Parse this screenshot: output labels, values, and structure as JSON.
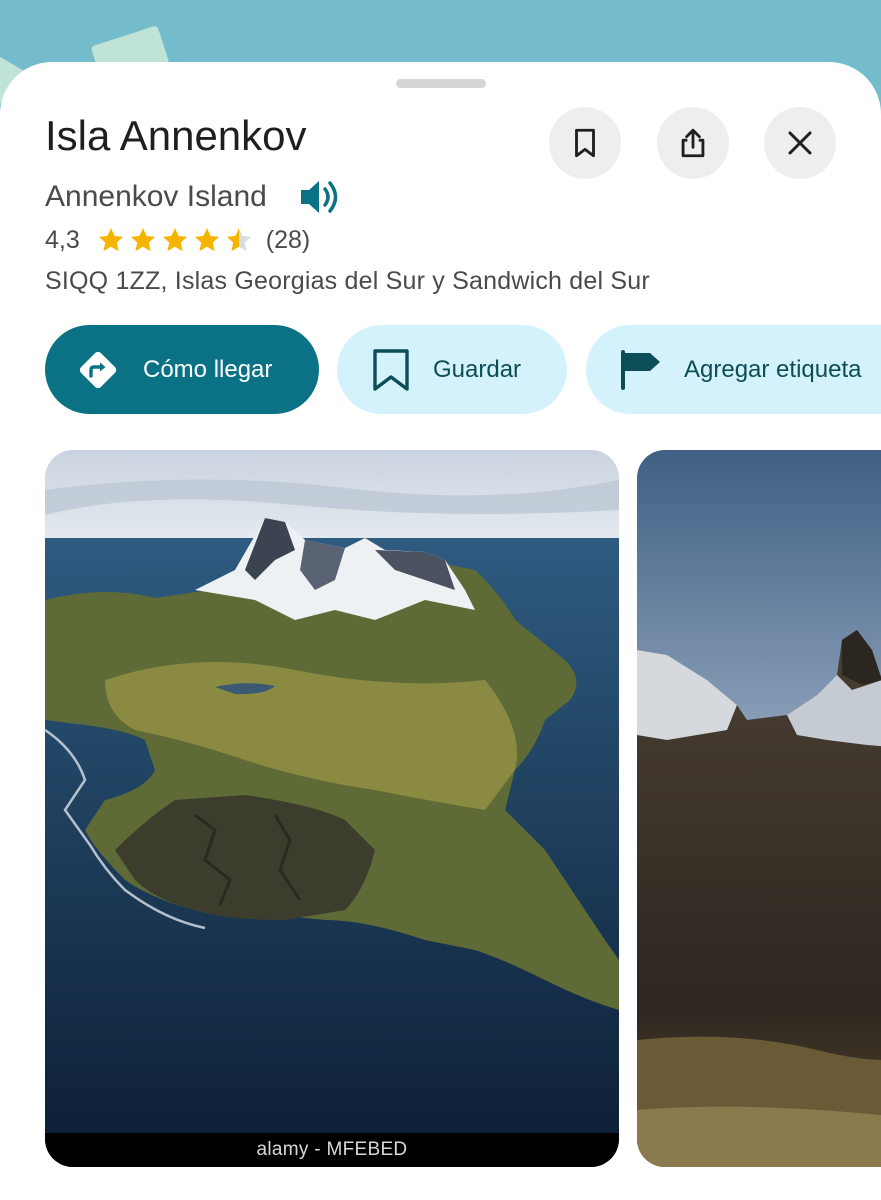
{
  "place": {
    "title": "Isla Annenkov",
    "subtitle": "Annenkov Island",
    "rating": "4,3",
    "rating_value": 4.3,
    "review_count": "(28)",
    "address": "SIQQ 1ZZ, Islas Georgias del Sur y Sandwich del Sur"
  },
  "header_actions": [
    {
      "icon": "bookmark-icon"
    },
    {
      "icon": "share-icon"
    },
    {
      "icon": "close-icon"
    }
  ],
  "chips": {
    "directions": {
      "label": "Cómo llegar",
      "icon": "directions-icon"
    },
    "save": {
      "label": "Guardar",
      "icon": "bookmark-outline-icon"
    },
    "label": {
      "label": "Agregar etiqueta",
      "icon": "flag-icon"
    }
  },
  "photos": [
    {
      "watermark": "alamy - MFEBED"
    },
    {}
  ],
  "colors": {
    "primary": "#0b7285",
    "chip_bg": "#d3f2fb",
    "star": "#f6b400",
    "map": "#74bccc"
  }
}
